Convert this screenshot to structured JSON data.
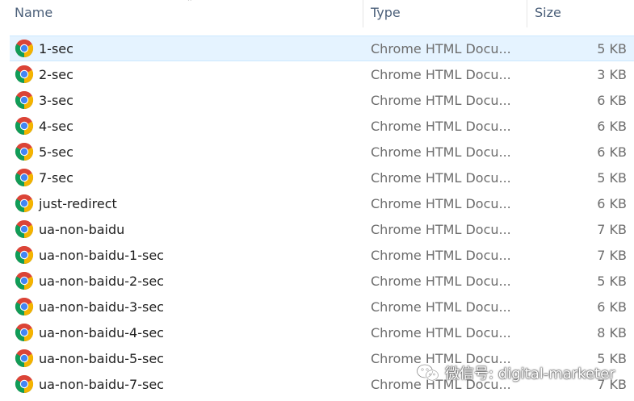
{
  "columns": {
    "name": "Name",
    "type": "Type",
    "size": "Size"
  },
  "file_icon": "chrome-icon",
  "rows": [
    {
      "name": "1-sec",
      "type": "Chrome HTML Docu...",
      "size": "5 KB",
      "selected": true
    },
    {
      "name": "2-sec",
      "type": "Chrome HTML Docu...",
      "size": "3 KB"
    },
    {
      "name": "3-sec",
      "type": "Chrome HTML Docu...",
      "size": "6 KB"
    },
    {
      "name": "4-sec",
      "type": "Chrome HTML Docu...",
      "size": "6 KB"
    },
    {
      "name": "5-sec",
      "type": "Chrome HTML Docu...",
      "size": "6 KB"
    },
    {
      "name": "7-sec",
      "type": "Chrome HTML Docu...",
      "size": "5 KB"
    },
    {
      "name": "just-redirect",
      "type": "Chrome HTML Docu...",
      "size": "6 KB"
    },
    {
      "name": "ua-non-baidu",
      "type": "Chrome HTML Docu...",
      "size": "7 KB"
    },
    {
      "name": "ua-non-baidu-1-sec",
      "type": "Chrome HTML Docu...",
      "size": "7 KB"
    },
    {
      "name": "ua-non-baidu-2-sec",
      "type": "Chrome HTML Docu...",
      "size": "5 KB"
    },
    {
      "name": "ua-non-baidu-3-sec",
      "type": "Chrome HTML Docu...",
      "size": "6 KB"
    },
    {
      "name": "ua-non-baidu-4-sec",
      "type": "Chrome HTML Docu...",
      "size": "8 KB"
    },
    {
      "name": "ua-non-baidu-5-sec",
      "type": "Chrome HTML Docu...",
      "size": "5 KB"
    },
    {
      "name": "ua-non-baidu-7-sec",
      "type": "Chrome HTML Docu...",
      "size": "7 KB"
    }
  ],
  "watermark": {
    "text": "微信号: digital-marketer",
    "icon": "wechat-icon"
  },
  "colors": {
    "selection_bg": "#e5f3ff",
    "selection_border": "#cce8ff",
    "header_text": "#4c607a",
    "secondary_text": "#6d6d6d"
  }
}
